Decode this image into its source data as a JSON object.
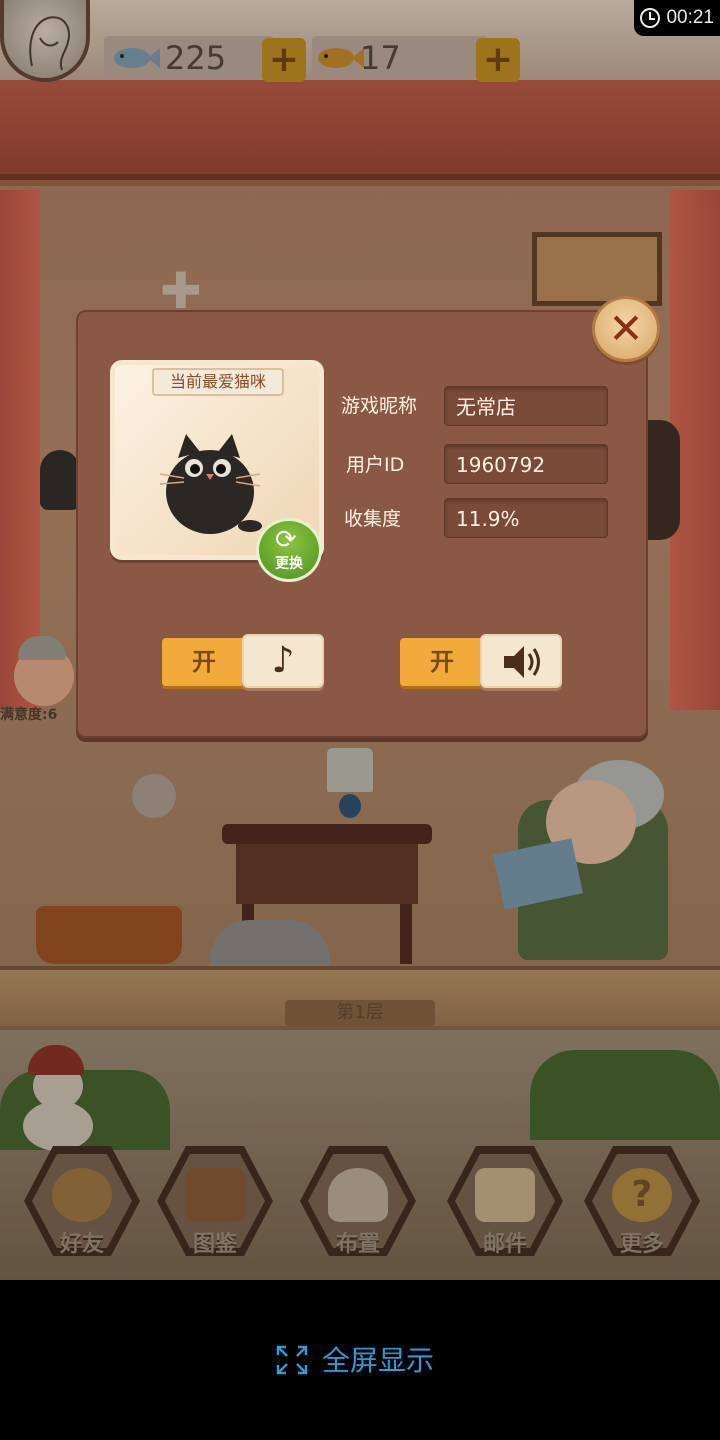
{
  "hud": {
    "fish_blue_count": "225",
    "fish_gold_count": "17",
    "plus_label": "+",
    "time": "00:21"
  },
  "dialog": {
    "card_title": "当前最爱猫咪",
    "swap_label": "更换",
    "close_label": "✕",
    "fields": [
      {
        "label": "游戏昵称",
        "value": "无常店"
      },
      {
        "label": "用户ID",
        "value": "1960792"
      },
      {
        "label": "收集度",
        "value": "11.9%"
      }
    ],
    "music_toggle": {
      "state_label": "开",
      "icon": "music-note-icon",
      "glyph": "♪"
    },
    "sound_toggle": {
      "state_label": "开",
      "icon": "speaker-icon",
      "glyph": "🔊"
    }
  },
  "scene": {
    "floor_label": "第1层",
    "side_label": "满意度:6"
  },
  "nav": [
    {
      "label": "好友",
      "icon": "friends-icon"
    },
    {
      "label": "图鉴",
      "icon": "catalog-book-icon"
    },
    {
      "label": "布置",
      "icon": "decorate-icon"
    },
    {
      "label": "邮件",
      "icon": "mail-icon"
    },
    {
      "label": "更多",
      "icon": "more-icon"
    }
  ],
  "footer": {
    "fullscreen_label": "全屏显示"
  },
  "colors": {
    "dialog_bg": "#8b5846",
    "toggle_on": "#f2ab3a",
    "swap_green": "#5fa52c",
    "fullscreen_blue": "#2e9ad8"
  }
}
